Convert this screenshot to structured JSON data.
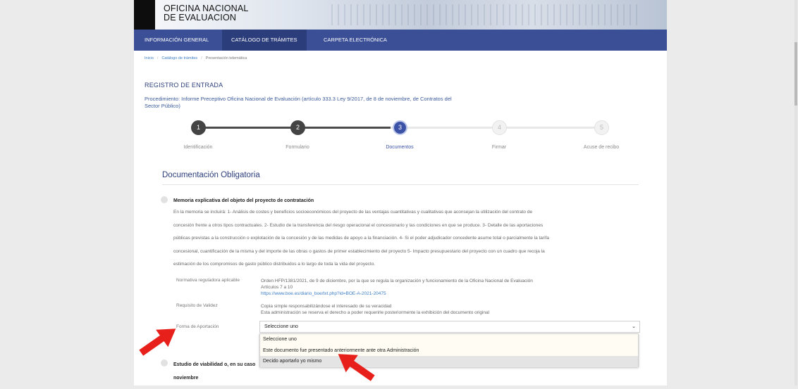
{
  "header": {
    "logo_line1": "OFICINA NACIONAL",
    "logo_line2": "DE EVALUACION"
  },
  "nav": {
    "items": [
      {
        "label": "INFORMACIÓN GENERAL"
      },
      {
        "label": "CATÁLOGO DE TRÁMITES"
      },
      {
        "label": "CARPETA ELECTRÓNICA"
      }
    ],
    "active_index": 1
  },
  "breadcrumb": {
    "items": [
      "Inicio",
      "Catálogo de trámites",
      "Presentación telemática"
    ]
  },
  "registro": {
    "title": "REGISTRO DE ENTRADA",
    "procedimiento_line1": "Procedimiento: Informe Preceptivo Oficina Nacional de Evaluación (artículo 333.3 Ley 9/2017, de 8 de noviembre, de Contratos del",
    "procedimiento_line2": "Sector Público)"
  },
  "steps": [
    {
      "number": "1",
      "label": "Identificación",
      "state": "done"
    },
    {
      "number": "2",
      "label": "Formulario",
      "state": "done"
    },
    {
      "number": "3",
      "label": "Documentos",
      "state": "current"
    },
    {
      "number": "4",
      "label": "Firmar",
      "state": "pending"
    },
    {
      "number": "5",
      "label": "Acuse de recibo",
      "state": "pending"
    }
  ],
  "section": {
    "title": "Documentación Obligatoria"
  },
  "document": {
    "title": "Memoria explicativa del objeto del proyecto de contratación",
    "description_lines": [
      "En la memoria se incluirá: 1- Análisis de costes y beneficios socioeconómicos del proyecto de las ventajas cuantitativas y cualitativas que aconsejan la utilización del contrato de",
      "concesión frente a otros tipos contractuales. 2- Estudio de la transferencia del riesgo operacional el concesionario y las condiciones en que se produce. 3- Detalle de las aportaciones",
      "públicas previstas a la construcción o explotación de la concesión y de las medidas de apoyo a la financiación. 4- Si el poder adjudicador concedente asume total o parcialmente la tarifa",
      "concesional, cuantificación de la misma y del importe de las obras o gastos de primer establecimiento del proyecto 5- Impacto presupuestario del proyecto con un cuadro que recoja la",
      "estimación de los compromisos de gasto público distribuidos a lo largo de toda la vida del proyecto."
    ],
    "normativa_label": "Normativa reguladora aplicable",
    "normativa_line1": "Orden HFP/1381/2021, de 9 de diciembre, por la que se regula la organización y funcionamiento de la Oficina Nacional de Evaluación",
    "normativa_line2": "Artículos 7 a 10",
    "normativa_link": "https://www.boe.es/diario_boe/txt.php?id=BOE-A-2021-20475",
    "requisito_label": "Requisito de Validez",
    "requisito_line1": "Copia simple responsabilizándose el interesado de su veracidad",
    "requisito_line2": "Esta administración se reserva el derecho a poder requerirle posteriormente la exhibición del documento original",
    "forma_label": "Forma de Aportación",
    "select_value": "Seleccione uno",
    "options": [
      {
        "label": "Seleccione uno"
      },
      {
        "label": "Este documento fue presentado anteriormente ante otra Administración"
      },
      {
        "label": "Decido aportarlo yo mismo"
      }
    ],
    "highlighted_option_index": 2
  },
  "document2": {
    "title_line1": "Estudio de viabilidad o, en su caso",
    "title_line2": "noviembre"
  },
  "colors": {
    "nav": "#3b4f96",
    "accent": "#3b52a6",
    "annotation_arrow": "#e8201b"
  },
  "icons": {
    "select_chevron": "chevron-down-icon",
    "annotation": "red-arrow-icon"
  }
}
